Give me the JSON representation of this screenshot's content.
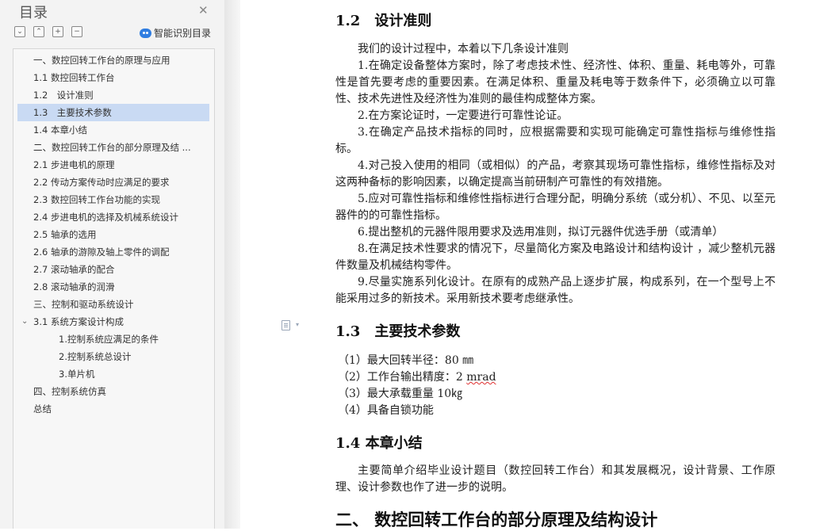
{
  "sidebar": {
    "title": "目录",
    "smart_toc_label": "智能识别目录",
    "toolbar": {
      "collapse_all": "⌄",
      "collapse_level": "⌃",
      "expand": "+",
      "shrink": "−"
    },
    "toc_items": [
      {
        "label": "一、数控回转工作台的原理与应用"
      },
      {
        "label": "1.1 数控回转工作台"
      },
      {
        "label": "1.2　设计准则"
      },
      {
        "label": "1.3　主要技术参数",
        "active": true
      },
      {
        "label": "1.4 本章小结"
      },
      {
        "label": "二、数控回转工作台的部分原理及结 ..."
      },
      {
        "label": "2.1 步进电机的原理"
      },
      {
        "label": "2.2 传动方案传动时应满足的要求"
      },
      {
        "label": "2.3 数控回转工作台功能的实现"
      },
      {
        "label": "2.4 步进电机的选择及机械系统设计"
      },
      {
        "label": "2.5 轴承的选用"
      },
      {
        "label": "2.6 轴承的游隙及轴上零件的调配"
      },
      {
        "label": "2.7 滚动轴承的配合"
      },
      {
        "label": "2.8 滚动轴承的润滑"
      },
      {
        "label": "三、控制和驱动系统设计"
      },
      {
        "label": "3.1 系统方案设计构成",
        "expanded": true
      },
      {
        "label": "1.控制系统应满足的条件"
      },
      {
        "label": "2.控制系统总设计"
      },
      {
        "label": "3.单片机"
      },
      {
        "label": "四、控制系统仿真"
      },
      {
        "label": "总结"
      }
    ]
  },
  "document": {
    "heading_1_2": "1.2　设计准则",
    "p_intro": "我们的设计过程中，本着以下几条设计准则",
    "p1": "1.在确定设备整体方案时，除了考虑技术性、经济性、体积、重量、耗电等外，可靠性是首先要考虑的重要因素。在满足体积、重量及耗电等于数条件下，必须确立以可靠性、技术先进性及经济性为准则的最佳构成整体方案。",
    "p2": "2.在方案论证时，一定要进行可靠性论证。",
    "p3": "3.在确定产品技术指标的同时，应根据需要和实现可能确定可靠性指标与维修性指标。",
    "p4": "4.对己投入使用的相同（或相似）的产品，考察其现场可靠性指标，维修性指标及对这两种备标的影响因素，以确定提高当前研制产可靠性的有效措施。",
    "p5": "5.应对可靠性指标和维修性指标进行合理分配，明确分系统（或分机）、不见、以至元器件的的可靠性指标。",
    "p6": "6.提出整机的元器件限用要求及选用准则，拟订元器件优选手册（或清单）",
    "p8": "8.在满足技术性要求的情况下，尽量简化方案及电路设计和结构设计 ，减少整机元器件数量及机械结构零件。",
    "p9": "9.尽量实施系列化设计。在原有的成熟产品上逐步扩展，构成系列，在一个型号上不能采用过多的新技术。采用新技术要考虑继承性。",
    "heading_1_3": "1.3　主要技术参数",
    "param1": "（1）最大回转半径：80 ㎜",
    "param2_prefix": "（2）工作台输出精度：2 ",
    "param2_unit": "mrad",
    "param3": "（3）最大承载重量 10㎏",
    "param4": "（4）具备自锁功能",
    "heading_1_4": "1.4  本章小结",
    "summary": "主要简单介绍毕业设计题目（数控回转工作台）和其发展概况，设计背景、工作原理、设计参数也作了进一步的说明。",
    "heading_ch2": "二、 数控回转工作台的部分原理及结构设计"
  }
}
